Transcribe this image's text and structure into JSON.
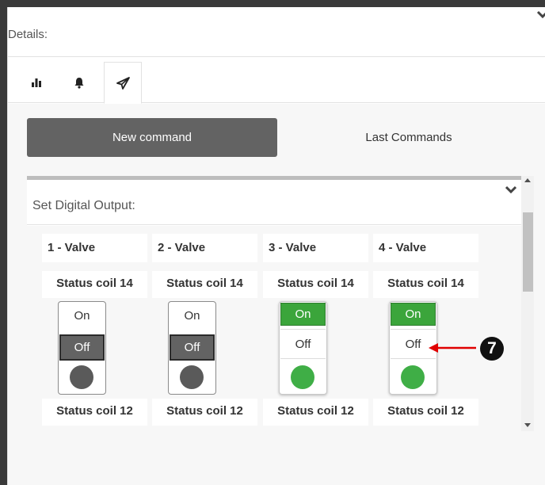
{
  "details": {
    "title": "Details:"
  },
  "tabs": [
    {
      "icon": "bar-chart-icon",
      "active": false
    },
    {
      "icon": "bell-icon",
      "active": false
    },
    {
      "icon": "send-icon",
      "active": true
    }
  ],
  "commands": {
    "new_command_label": "New command",
    "last_commands_label": "Last Commands"
  },
  "set_digital_output": {
    "title": "Set Digital Output:"
  },
  "valves": [
    {
      "name": "1 - Valve",
      "status_label": "Status coil 14",
      "next_status_label": "Status coil 12",
      "on_label": "On",
      "off_label": "Off",
      "state": "off"
    },
    {
      "name": "2 - Valve",
      "status_label": "Status coil 14",
      "next_status_label": "Status coil 12",
      "on_label": "On",
      "off_label": "Off",
      "state": "off"
    },
    {
      "name": "3 - Valve",
      "status_label": "Status coil 14",
      "next_status_label": "Status coil 12",
      "on_label": "On",
      "off_label": "Off",
      "state": "on"
    },
    {
      "name": "4 - Valve",
      "status_label": "Status coil 14",
      "next_status_label": "Status coil 12",
      "on_label": "On",
      "off_label": "Off",
      "state": "on"
    }
  ],
  "annotation": {
    "number": "7",
    "arrow_color": "#e00000"
  },
  "colors": {
    "on_green": "#3ba53b",
    "off_dark": "#636363",
    "led_on": "#3fae46",
    "led_off": "#5a5a5a"
  }
}
